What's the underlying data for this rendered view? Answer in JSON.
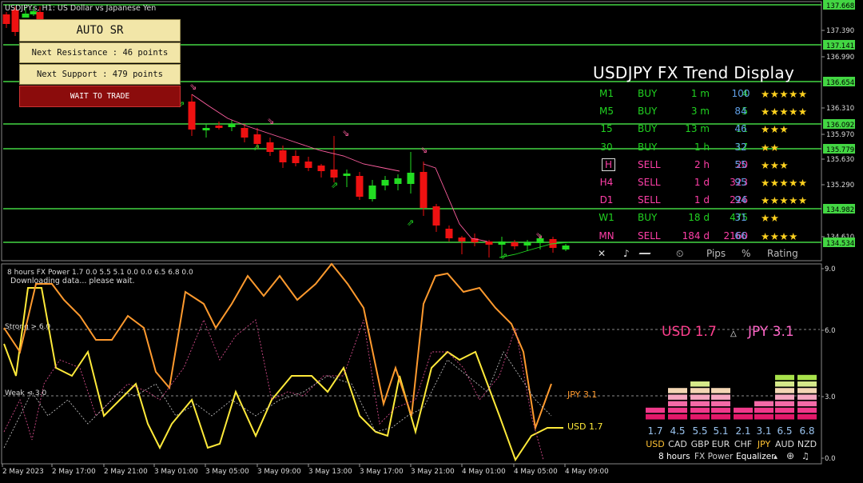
{
  "chart": {
    "symbol_title": "USDJPY.s, H1:  US Dollar vs Japanese Yen",
    "price_ticks": [
      {
        "label": "137.668",
        "highlight": true
      },
      {
        "label": "137.390",
        "highlight": false
      },
      {
        "label": "137.141",
        "highlight": true
      },
      {
        "label": "136.990",
        "highlight": false
      },
      {
        "label": "136.654",
        "highlight": true
      },
      {
        "label": "136.310",
        "highlight": false
      },
      {
        "label": "136.092",
        "highlight": true
      },
      {
        "label": "135.970",
        "highlight": false
      },
      {
        "label": "135.779",
        "highlight": true
      },
      {
        "label": "135.630",
        "highlight": false
      },
      {
        "label": "135.290",
        "highlight": false
      },
      {
        "label": "134.982",
        "highlight": true
      },
      {
        "label": "134.610",
        "highlight": false
      },
      {
        "label": "134.534",
        "highlight": true
      }
    ],
    "colors": {
      "sr_line": "#43d643",
      "bull": "#22dd22",
      "bear": "#ee1111",
      "ma": "#ff5fa0"
    }
  },
  "auto_sr": {
    "title": "AUTO  SR",
    "next_resistance": "Next Resistance : 46 points",
    "next_support": "Next Support : 479 points",
    "action": "WAIT TO TRADE"
  },
  "trend_display": {
    "title": "USDJPY FX Trend Display",
    "rows": [
      {
        "tf": "M1",
        "signal": "BUY",
        "duration": "1 m",
        "pips": "4",
        "pct": "100",
        "stars": "★★★★★",
        "boxed": false
      },
      {
        "tf": "M5",
        "signal": "BUY",
        "duration": "3 m",
        "pips": "5",
        "pct": "84",
        "stars": "★★★★★",
        "boxed": false
      },
      {
        "tf": "15",
        "signal": "BUY",
        "duration": "13 m",
        "pips": "11",
        "pct": "46",
        "stars": "★★★",
        "boxed": false
      },
      {
        "tf": "30",
        "signal": "BUY",
        "duration": "1 h",
        "pips": "17",
        "pct": "32",
        "stars": "★★",
        "boxed": false
      },
      {
        "tf": "H",
        "signal": "SELL",
        "duration": "2 h",
        "pips": "20",
        "pct": "55",
        "stars": "★★★",
        "boxed": true
      },
      {
        "tf": "H4",
        "signal": "SELL",
        "duration": "1 d",
        "pips": "323",
        "pct": "95",
        "stars": "★★★★★",
        "boxed": false
      },
      {
        "tf": "D1",
        "signal": "SELL",
        "duration": "1 d",
        "pips": "226",
        "pct": "94",
        "stars": "★★★★★",
        "boxed": false
      },
      {
        "tf": "W1",
        "signal": "BUY",
        "duration": "18 d",
        "pips": "475",
        "pct": "31",
        "stars": "★★",
        "boxed": false
      },
      {
        "tf": "MN",
        "signal": "SELL",
        "duration": "184 d",
        "pips": "2160",
        "pct": "66",
        "stars": "★★★★",
        "boxed": false
      }
    ],
    "header": {
      "close": "✕",
      "sound": "♪",
      "clock": "⏲",
      "pips": "Pips",
      "pct": "%",
      "rating": "Rating"
    }
  },
  "power": {
    "header": "8 hours  FX Power 1.7 0.0 5.5 5.1 0.0 0.0 6.5 6.8 0.0",
    "status": "Downloading data... please wait.",
    "strong_label": "Strong > 6.0",
    "weak_label": "Weak < 3.0",
    "y_ticks": [
      "9.0",
      "6.0",
      "3.0",
      "0.0"
    ],
    "x_labels": [
      "2 May 2023",
      "2 May 17:00",
      "2 May 21:00",
      "3 May 01:00",
      "3 May 05:00",
      "3 May 09:00",
      "3 May 13:00",
      "3 May 17:00",
      "3 May 21:00",
      "4 May 01:00",
      "4 May 05:00",
      "4 May 09:00"
    ],
    "usd_strength": "USD 1.7",
    "jpy_strength": "JPY 3.1",
    "jpy_line_label": "JPY 3.1",
    "usd_line_label": "USD 1.7",
    "colors": {
      "usd": "#ffea3a",
      "jpy": "#ff9a2e",
      "usd_big": "#ff3f8e",
      "jpy_big": "#ff66c8"
    },
    "equalizer": {
      "currencies": [
        "USD",
        "CAD",
        "GBP",
        "EUR",
        "CHF",
        "JPY",
        "AUD",
        "NZD"
      ],
      "values": [
        "1.7",
        "4.5",
        "5.5",
        "5.1",
        "2.1",
        "3.1",
        "6.5",
        "6.8"
      ],
      "selected": [
        "USD",
        "JPY"
      ],
      "footer": {
        "hours": "8 hours",
        "app": "FX Power",
        "eq": "Equalizer"
      }
    }
  }
}
